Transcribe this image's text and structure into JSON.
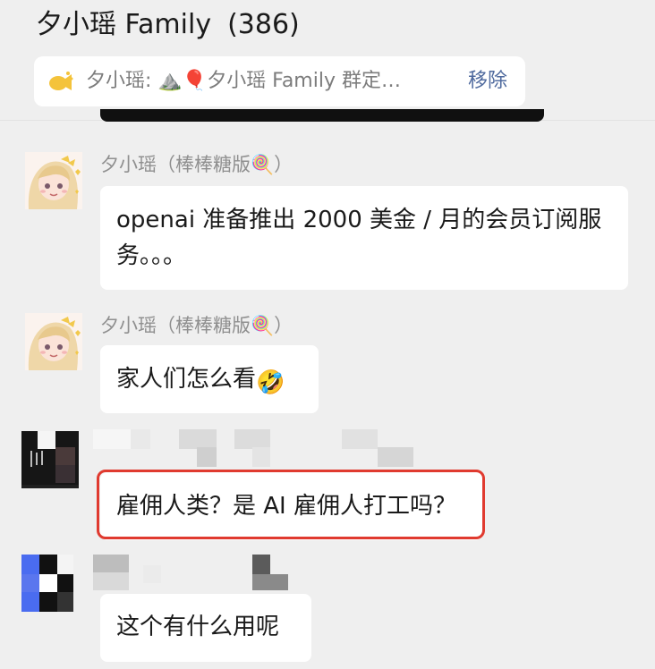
{
  "header": {
    "group_name": "夕小瑶 Family",
    "member_count": "(386)"
  },
  "pinned": {
    "icon": "megaphone-icon",
    "text": "夕小瑶: ⛰️🎈夕小瑶 Family 群定…",
    "remove_label": "移除"
  },
  "messages": [
    {
      "sender": "夕小瑶（棒棒糖版🍭）",
      "text": "openai 准备推出 2000 美金 / 月的会员订阅服务。。。",
      "avatar": "anime-girl-avatar"
    },
    {
      "sender": "夕小瑶（棒棒糖版🍭）",
      "text": "家人们怎么看",
      "emoji": "🤣",
      "avatar": "anime-girl-avatar"
    },
    {
      "sender": "",
      "text": "雇佣人类？是 AI 雇佣人打工吗？",
      "avatar": "pixelated-avatar",
      "highlighted": true
    },
    {
      "sender": "",
      "text": "这个有什么用呢",
      "avatar": "pixelated-blue-avatar"
    }
  ],
  "colors": {
    "background": "#efefef",
    "bubble": "#ffffff",
    "link": "#4f6a9e",
    "highlight_border": "#e03a2f"
  }
}
